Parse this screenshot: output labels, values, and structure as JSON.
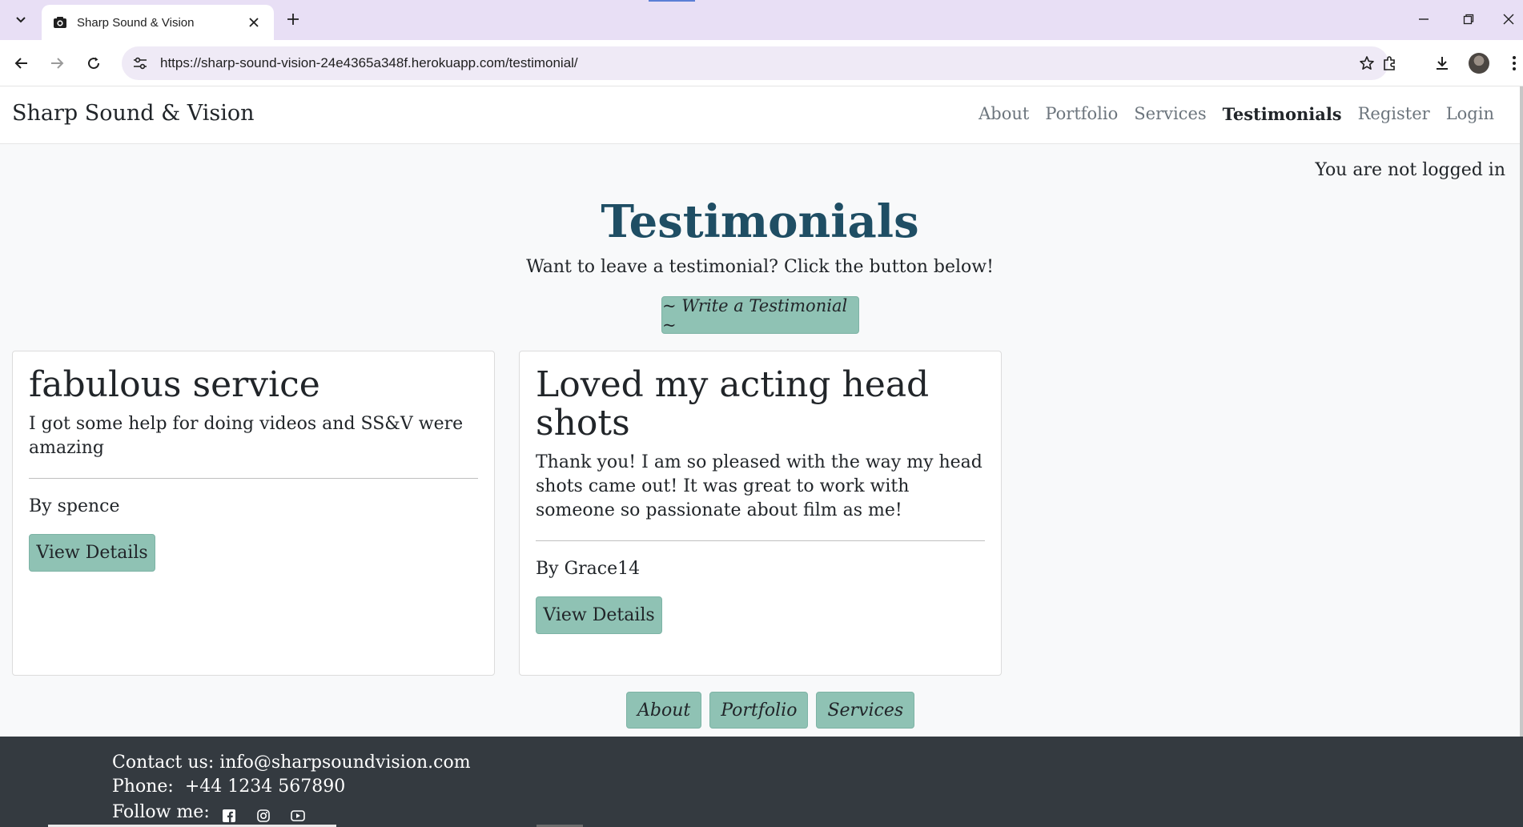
{
  "browser": {
    "tab": {
      "title": "Sharp Sound & Vision",
      "favicon": "camera-icon"
    },
    "url": "https://sharp-sound-vision-24e4365a348f.herokuapp.com/testimonial/"
  },
  "navbar": {
    "brand": "Sharp Sound & Vision",
    "links": [
      "About",
      "Portfolio",
      "Services",
      "Testimonials",
      "Register",
      "Login"
    ],
    "active": "Testimonials"
  },
  "status": "You are not logged in",
  "hero": {
    "title": "Testimonials",
    "subtitle": "Want to leave a testimonial? Click the button below!",
    "button": "~ Write a Testimonial ~"
  },
  "testimonials": [
    {
      "title": "fabulous service",
      "text": "I got some help for doing videos and SS&V were amazing",
      "author": "By spence",
      "button": "View Details"
    },
    {
      "title": "Loved my acting head shots",
      "text": "Thank you! I am so pleased with the way my head shots came out! It was great to work with someone so passionate about film as me!",
      "author": "By Grace14",
      "button": "View Details"
    }
  ],
  "footer_links": [
    "About",
    "Portfolio",
    "Services"
  ],
  "footer": {
    "contact": "Contact us: info@sharpsoundvision.com",
    "phone_label": "Phone:",
    "phone_value": "+44 1234 567890",
    "follow": "Follow me:",
    "social_icons": [
      "facebook-icon",
      "instagram-icon",
      "youtube-icon"
    ]
  },
  "colors": {
    "accent": "#8fc2b4",
    "heading": "#1f4e64",
    "footer_bg": "#343a40",
    "chrome_bg": "#e8dff5"
  }
}
